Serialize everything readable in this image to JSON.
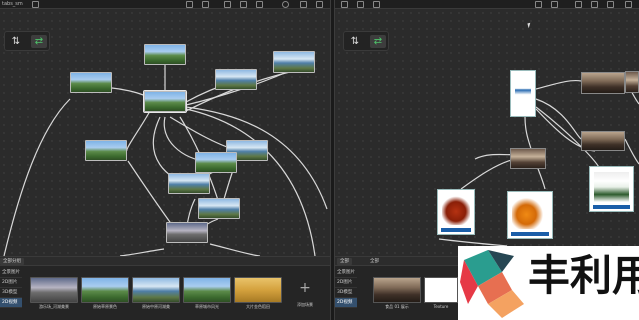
{
  "left_pane": {
    "topbar": {
      "app_label": "tabs_sm"
    },
    "tools": [
      {
        "name": "swap-tool",
        "glyph": "⇅",
        "active": false
      },
      {
        "name": "link-tool",
        "glyph": "⇄",
        "active": true
      }
    ],
    "library": {
      "tabs": [
        "全部分组"
      ],
      "filters": [
        "全景图片",
        "2D图片",
        "3D模型",
        "2D视频"
      ],
      "active_filter": 3,
      "assets": [
        {
          "label": "游乐场_河湖美景",
          "style": "sunset"
        },
        {
          "label": "原始草原景色",
          "style": "pano"
        },
        {
          "label": "原始中原河湖美",
          "style": "lake"
        },
        {
          "label": "草原城市风光",
          "style": "pano"
        },
        {
          "label": "大片金色稻田",
          "style": "sunset"
        }
      ],
      "add_label": "添加场景"
    }
  },
  "right_pane": {
    "tools": [
      {
        "name": "swap-tool",
        "glyph": "⇅",
        "active": false
      },
      {
        "name": "link-tool",
        "glyph": "⇄",
        "active": true
      }
    ],
    "library": {
      "tabs": [
        "全部",
        "全部"
      ],
      "active_tab": 0,
      "filters": [
        "全景图片",
        "2D图片",
        "3D模型",
        "2D视频"
      ],
      "active_filter": 3,
      "assets": [
        {
          "label": "食品 01 展示",
          "style": "photo"
        },
        {
          "label": "Texture",
          "style": "brand"
        }
      ]
    }
  },
  "watermark": {
    "text": "丰利用"
  },
  "colors": {
    "accent_green": "#4fc36a",
    "active_filter": "#34506e",
    "caption_blue": "#1a5ea8"
  }
}
